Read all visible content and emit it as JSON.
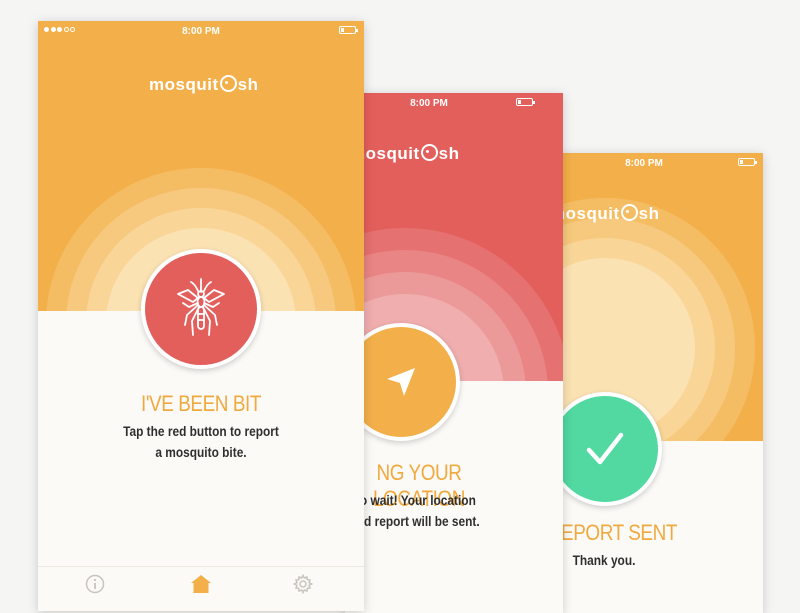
{
  "colors": {
    "amber": "#f3b04a",
    "red": "#e35f5c",
    "green": "#52d8a1",
    "background": "#f5f5f4",
    "card": "#fbfaf6"
  },
  "screen1": {
    "status_time": "8:00 PM",
    "logo": {
      "prefix": "mosquit",
      "suffix": "sh"
    },
    "title": "I'VE BEEN BIT",
    "desc_line1": "Tap the red button to report",
    "desc_line2": "a mosquito bite.",
    "button_icon": "mosquito-icon",
    "tabs": [
      {
        "icon": "info-icon"
      },
      {
        "icon": "home-icon",
        "active": true
      },
      {
        "icon": "gear-icon"
      }
    ]
  },
  "screen2": {
    "status_time": "8:00 PM",
    "logo": {
      "prefix": "mosquit",
      "suffix": "sh"
    },
    "title": "NG YOUR LOCATION",
    "desc_line1": "eed to wait! Your location",
    "desc_line2": "red and report will be sent.",
    "button_icon": "location-arrow-icon"
  },
  "screen3": {
    "status_time": "8:00 PM",
    "logo": {
      "prefix": "mosquit",
      "suffix": "sh"
    },
    "title": "EPORT SENT",
    "desc_line1": "Thank you.",
    "button_icon": "checkmark-icon"
  }
}
